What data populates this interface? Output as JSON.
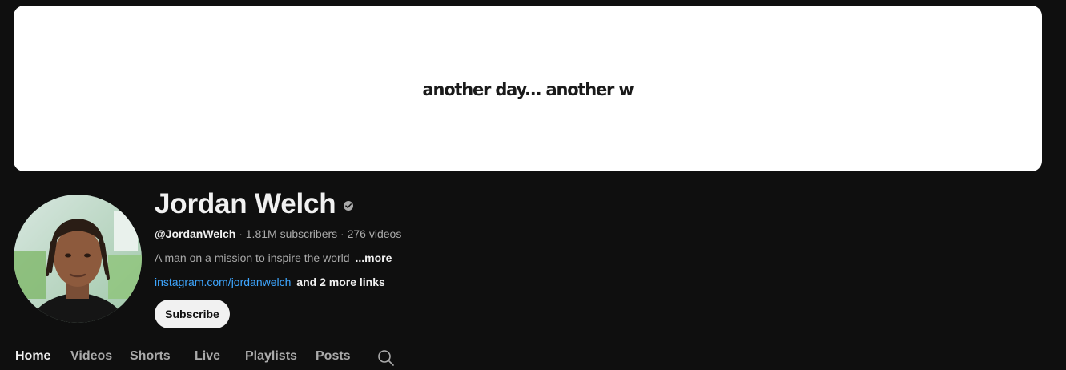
{
  "banner": {
    "text": "another day... another w"
  },
  "channel": {
    "name": "Jordan Welch",
    "handle": "@JordanWelch",
    "subscribers": "1.81M subscribers",
    "videos": "276 videos",
    "separator": " · ",
    "description": "A man on a mission to inspire the world",
    "more_label": "...more",
    "link_text": "instagram.com/jordanwelch",
    "more_links": "and 2 more links",
    "subscribe_label": "Subscribe",
    "icons": {
      "verified": "verified-check-icon",
      "avatar": "profile-avatar"
    }
  },
  "tabs": [
    {
      "label": "Home",
      "active": true
    },
    {
      "label": "Videos",
      "active": false
    },
    {
      "label": "Shorts",
      "active": false
    },
    {
      "label": "Live",
      "active": false
    },
    {
      "label": "Playlists",
      "active": false
    },
    {
      "label": "Posts",
      "active": false
    }
  ],
  "search_icon": "search-icon",
  "colors": {
    "background": "#0f0f0f",
    "link": "#3ea6ff",
    "text_primary": "#f1f1f1",
    "text_secondary": "#aaaaaa"
  }
}
